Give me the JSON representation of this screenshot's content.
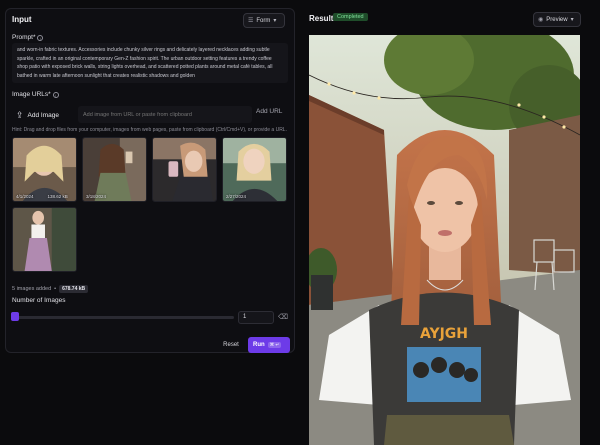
{
  "input": {
    "title": "Input",
    "form_dropdown": "Form",
    "prompt_label": "Prompt*",
    "prompt_text": "and worn-in fabric textures. Accessories include chunky silver rings and delicately layered necklaces adding subtle sparkle, crafted in an original contemporary Gen-Z fashion spirit. The urban outdoor setting features a trendy coffee shop patio with exposed brick walls, string lights overhead, and scattered potted plants around metal café tables, all bathed in warm late afternoon sunlight that creates realistic shadows and golden",
    "image_urls_label": "Image URLs*",
    "add_image_label": "Add Image",
    "url_placeholder": "Add image from URL or paste from clipboard",
    "add_url_label": "Add URL",
    "hint": "Hint: Drag and drop files from your computer, images from web pages, paste from clipboard (Ctrl/Cmd+V), or provide a URL.",
    "thumbnails": [
      {
        "date": "4/1/2024",
        "size": "138.62 kB"
      },
      {
        "date": "3/18/2024",
        "size": ""
      },
      {
        "date": "",
        "size": ""
      },
      {
        "date": "2/27/2024",
        "size": ""
      },
      {
        "date": "",
        "size": ""
      }
    ],
    "images_added": "5 images added",
    "total_size": "678.74 kB",
    "num_images_label": "Number of Images",
    "num_images_value": "1",
    "num_images_fraction": 0.0,
    "reset_label": "Reset",
    "run_label": "Run",
    "run_shortcut": "⌘ ↵"
  },
  "result": {
    "title": "Result",
    "status": "Completed",
    "preview_dropdown": "Preview"
  },
  "colors": {
    "accent": "#6d3be8",
    "status_bg": "#1f4d2a",
    "status_text": "#7fe09a"
  },
  "icons": {
    "form_dropdown_icon": "list-icon",
    "preview_dropdown_icon": "eye-icon",
    "upload": "upload-icon",
    "eraser": "eraser-icon"
  }
}
